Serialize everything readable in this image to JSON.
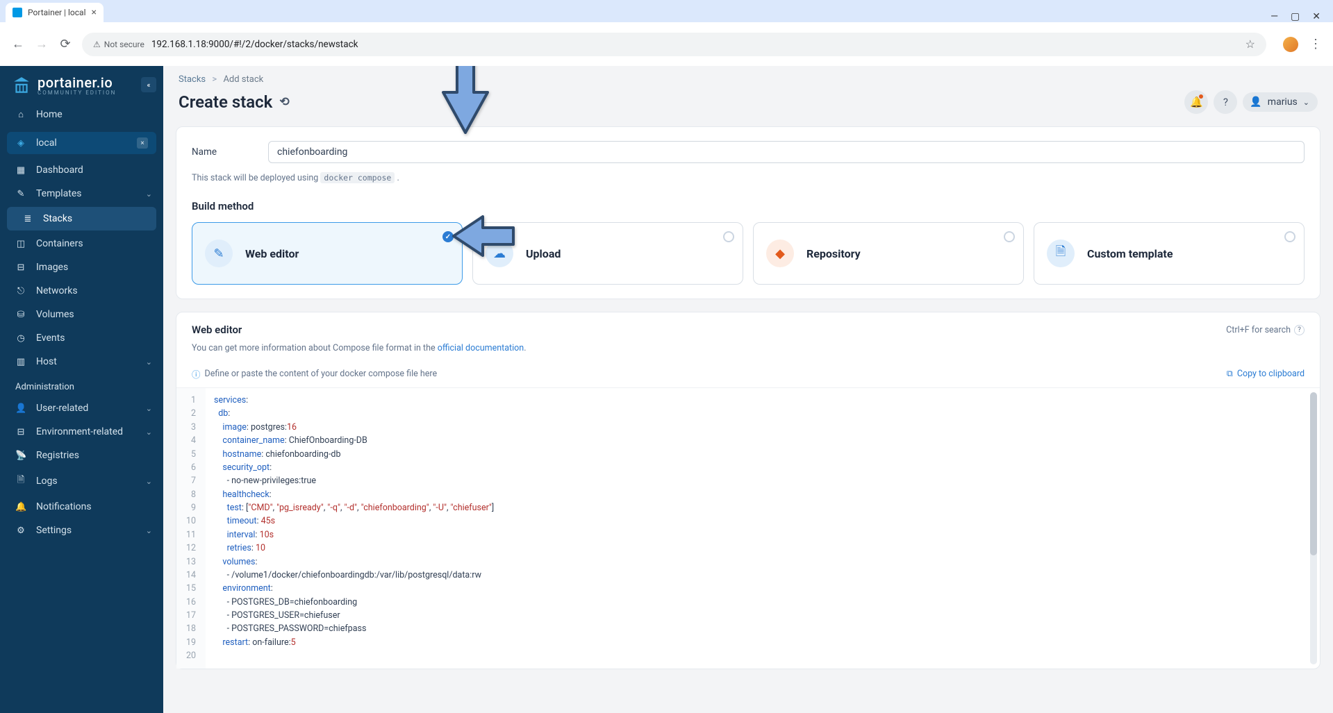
{
  "browser": {
    "tab_title": "Portainer | local",
    "url": "192.168.1.18:9000/#!/2/docker/stacks/newstack",
    "security_label": "Not secure"
  },
  "sidebar": {
    "brand": "portainer.io",
    "brand_sub": "COMMUNITY EDITION",
    "home": "Home",
    "env_name": "local",
    "items": [
      {
        "label": "Dashboard"
      },
      {
        "label": "Templates"
      },
      {
        "label": "Stacks"
      },
      {
        "label": "Containers"
      },
      {
        "label": "Images"
      },
      {
        "label": "Networks"
      },
      {
        "label": "Volumes"
      },
      {
        "label": "Events"
      },
      {
        "label": "Host"
      }
    ],
    "admin_label": "Administration",
    "admin_items": [
      {
        "label": "User-related"
      },
      {
        "label": "Environment-related"
      },
      {
        "label": "Registries"
      },
      {
        "label": "Logs"
      },
      {
        "label": "Notifications"
      },
      {
        "label": "Settings"
      }
    ]
  },
  "breadcrumb": {
    "root": "Stacks",
    "current": "Add stack"
  },
  "page": {
    "title": "Create stack",
    "user": "marius",
    "name_label": "Name",
    "name_value": "chiefonboarding",
    "deploy_note_pre": "This stack will be deployed using ",
    "deploy_note_code": "docker compose",
    "build_method_title": "Build method",
    "methods": [
      {
        "label": "Web editor"
      },
      {
        "label": "Upload"
      },
      {
        "label": "Repository"
      },
      {
        "label": "Custom template"
      }
    ],
    "editor_title": "Web editor",
    "search_hint": "Ctrl+F for search",
    "editor_help_pre": "You can get more information about Compose file format in the ",
    "editor_help_link": "official documentation",
    "placeholder_hint": "Define or paste the content of your docker compose file here",
    "copy_label": "Copy to clipboard"
  },
  "compose": {
    "lines": 20,
    "raw": "services:\n  db:\n    image: postgres:16\n    container_name: ChiefOnboarding-DB\n    hostname: chiefonboarding-db\n    security_opt:\n      - no-new-privileges:true\n    healthcheck:\n      test: [\"CMD\", \"pg_isready\", \"-q\", \"-d\", \"chiefonboarding\", \"-U\", \"chiefuser\"]\n      timeout: 45s\n      interval: 10s\n      retries: 10\n    volumes:\n      - /volume1/docker/chiefonboardingdb:/var/lib/postgresql/data:rw\n    environment:\n      - POSTGRES_DB=chiefonboarding\n      - POSTGRES_USER=chiefuser\n      - POSTGRES_PASSWORD=chiefpass\n    restart: on-failure:5\n"
  }
}
